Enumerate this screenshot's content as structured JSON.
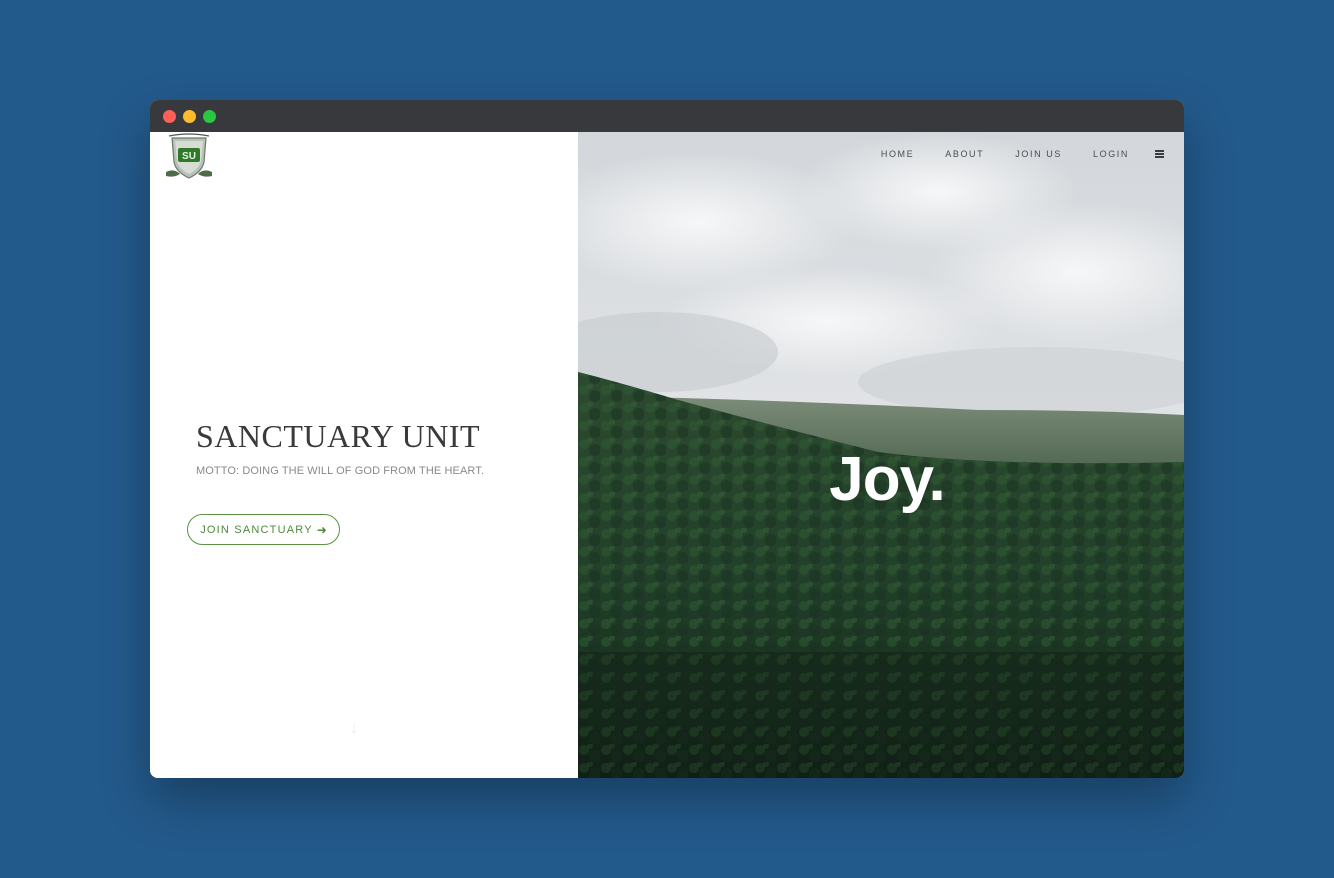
{
  "brand": {
    "title": "SANCTUARY UNIT",
    "motto": "MOTTO: DOING THE WILL OF GOD FROM THE HEART.",
    "logo_text": "SU",
    "cta_label": "JOIN SANCTUARY",
    "cta_icon": "arrow-right-icon"
  },
  "nav": {
    "items": [
      {
        "label": "HOME"
      },
      {
        "label": "ABOUT"
      },
      {
        "label": "JOIN US"
      },
      {
        "label": "LOGIN"
      }
    ],
    "menu_icon": "hamburger-menu-icon"
  },
  "hero": {
    "word": "Joy."
  },
  "colors": {
    "page_background": "#235a8c",
    "titlebar": "#38393c",
    "accent_green": "#5d9245",
    "forest_dark": "#1f3a24",
    "sky": "#d9dcdf"
  }
}
